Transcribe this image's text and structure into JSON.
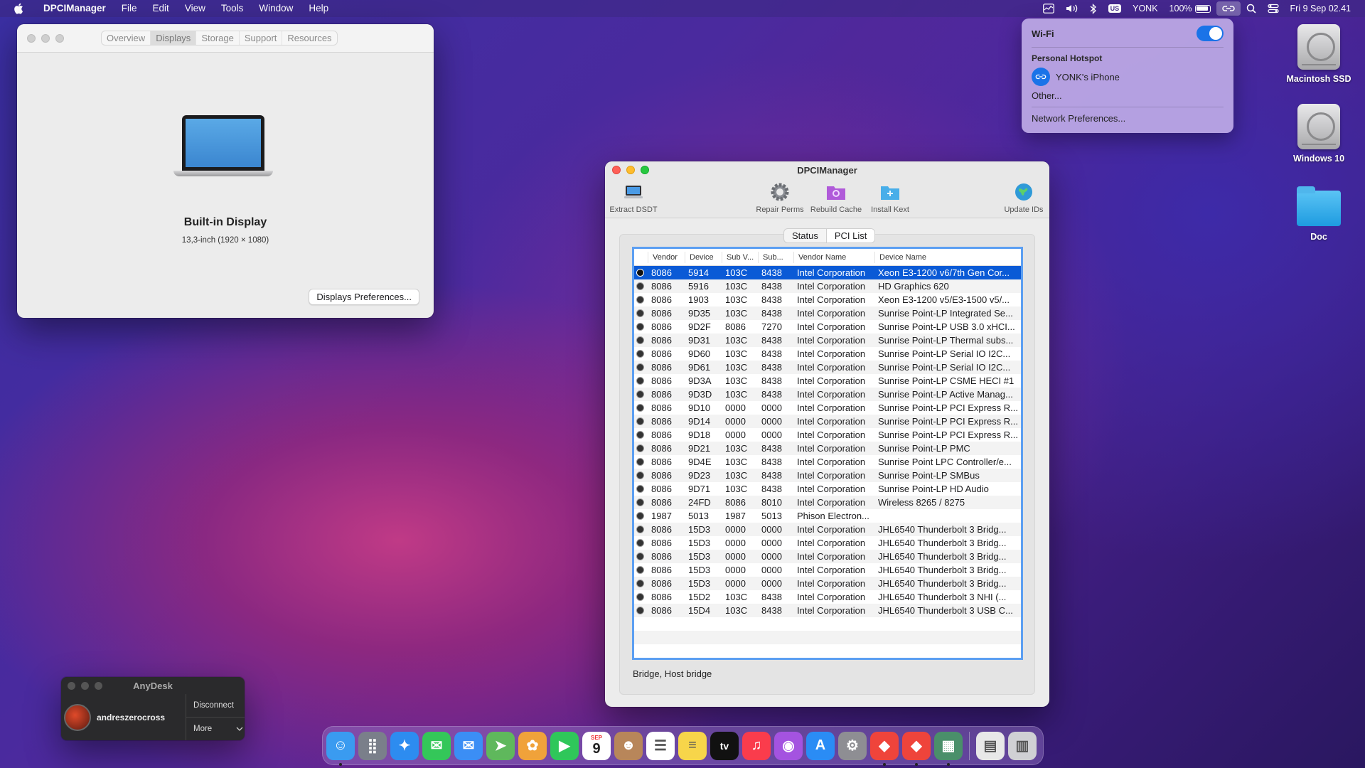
{
  "menubar": {
    "apple_icon": "apple-icon",
    "app_name": "DPCIManager",
    "menus": [
      "File",
      "Edit",
      "View",
      "Tools",
      "Window",
      "Help"
    ],
    "keyboard_badge": "US",
    "user": "YONK",
    "battery_percent": "100%",
    "datetime": "Fri 9 Sep  02.41"
  },
  "sysinfo": {
    "tabs": [
      "Overview",
      "Displays",
      "Storage",
      "Support",
      "Resources"
    ],
    "active_tab": "Displays",
    "display_name": "Built-in Display",
    "display_detail": "13,3-inch (1920 × 1080)",
    "prefs_button": "Displays Preferences..."
  },
  "dpci": {
    "title": "DPCIManager",
    "toolbar": {
      "extract": "Extract DSDT",
      "repair": "Repair Perms",
      "rebuild": "Rebuild Cache",
      "install": "Install Kext",
      "update": "Update IDs"
    },
    "tabs": [
      "Status",
      "PCI List"
    ],
    "active_tab": "PCI List",
    "columns": [
      "Vendor",
      "Device",
      "Sub V...",
      "Sub...",
      "Vendor Name",
      "Device Name"
    ],
    "rows": [
      [
        "8086",
        "5914",
        "103C",
        "8438",
        "Intel Corporation",
        "Xeon E3-1200 v6/7th Gen Cor..."
      ],
      [
        "8086",
        "5916",
        "103C",
        "8438",
        "Intel Corporation",
        "HD Graphics 620"
      ],
      [
        "8086",
        "1903",
        "103C",
        "8438",
        "Intel Corporation",
        "Xeon E3-1200 v5/E3-1500 v5/..."
      ],
      [
        "8086",
        "9D35",
        "103C",
        "8438",
        "Intel Corporation",
        "Sunrise Point-LP Integrated Se..."
      ],
      [
        "8086",
        "9D2F",
        "8086",
        "7270",
        "Intel Corporation",
        "Sunrise Point-LP USB 3.0 xHCI..."
      ],
      [
        "8086",
        "9D31",
        "103C",
        "8438",
        "Intel Corporation",
        "Sunrise Point-LP Thermal subs..."
      ],
      [
        "8086",
        "9D60",
        "103C",
        "8438",
        "Intel Corporation",
        "Sunrise Point-LP Serial IO I2C..."
      ],
      [
        "8086",
        "9D61",
        "103C",
        "8438",
        "Intel Corporation",
        "Sunrise Point-LP Serial IO I2C..."
      ],
      [
        "8086",
        "9D3A",
        "103C",
        "8438",
        "Intel Corporation",
        "Sunrise Point-LP CSME HECI #1"
      ],
      [
        "8086",
        "9D3D",
        "103C",
        "8438",
        "Intel Corporation",
        "Sunrise Point-LP Active Manag..."
      ],
      [
        "8086",
        "9D10",
        "0000",
        "0000",
        "Intel Corporation",
        "Sunrise Point-LP PCI Express R..."
      ],
      [
        "8086",
        "9D14",
        "0000",
        "0000",
        "Intel Corporation",
        "Sunrise Point-LP PCI Express R..."
      ],
      [
        "8086",
        "9D18",
        "0000",
        "0000",
        "Intel Corporation",
        "Sunrise Point-LP PCI Express R..."
      ],
      [
        "8086",
        "9D21",
        "103C",
        "8438",
        "Intel Corporation",
        "Sunrise Point-LP PMC"
      ],
      [
        "8086",
        "9D4E",
        "103C",
        "8438",
        "Intel Corporation",
        "Sunrise Point LPC Controller/e..."
      ],
      [
        "8086",
        "9D23",
        "103C",
        "8438",
        "Intel Corporation",
        "Sunrise Point-LP SMBus"
      ],
      [
        "8086",
        "9D71",
        "103C",
        "8438",
        "Intel Corporation",
        "Sunrise Point-LP HD Audio"
      ],
      [
        "8086",
        "24FD",
        "8086",
        "8010",
        "Intel Corporation",
        "Wireless 8265 / 8275"
      ],
      [
        "1987",
        "5013",
        "1987",
        "5013",
        "Phison Electron...",
        ""
      ],
      [
        "8086",
        "15D3",
        "0000",
        "0000",
        "Intel Corporation",
        "JHL6540 Thunderbolt 3 Bridg..."
      ],
      [
        "8086",
        "15D3",
        "0000",
        "0000",
        "Intel Corporation",
        "JHL6540 Thunderbolt 3 Bridg..."
      ],
      [
        "8086",
        "15D3",
        "0000",
        "0000",
        "Intel Corporation",
        "JHL6540 Thunderbolt 3 Bridg..."
      ],
      [
        "8086",
        "15D3",
        "0000",
        "0000",
        "Intel Corporation",
        "JHL6540 Thunderbolt 3 Bridg..."
      ],
      [
        "8086",
        "15D3",
        "0000",
        "0000",
        "Intel Corporation",
        "JHL6540 Thunderbolt 3 Bridg..."
      ],
      [
        "8086",
        "15D2",
        "103C",
        "8438",
        "Intel Corporation",
        "JHL6540 Thunderbolt 3 NHI (..."
      ],
      [
        "8086",
        "15D4",
        "103C",
        "8438",
        "Intel Corporation",
        "JHL6540 Thunderbolt 3 USB C..."
      ]
    ],
    "selected_row": 0,
    "status_text": "Bridge, Host bridge"
  },
  "wifi_menu": {
    "title": "Wi-Fi",
    "enabled": true,
    "section": "Personal Hotspot",
    "hotspot_name": "YONK's iPhone",
    "other": "Other...",
    "network_prefs": "Network Preferences..."
  },
  "desktop": {
    "items": [
      "Macintosh SSD",
      "Windows 10",
      "Doc"
    ]
  },
  "anydesk": {
    "title": "AnyDesk",
    "user": "andreszerocross",
    "disconnect": "Disconnect",
    "more": "More"
  },
  "dock": {
    "apps": [
      {
        "name": "Finder",
        "icon": "finder-icon",
        "color": "#3a9bf0"
      },
      {
        "name": "Launchpad",
        "icon": "launchpad-icon",
        "color": "#7a7f8a"
      },
      {
        "name": "Safari",
        "icon": "safari-icon",
        "color": "#2d8cf0"
      },
      {
        "name": "Messages",
        "icon": "messages-icon",
        "color": "#34c759"
      },
      {
        "name": "Mail",
        "icon": "mail-icon",
        "color": "#3b8ef5"
      },
      {
        "name": "Maps",
        "icon": "maps-icon",
        "color": "#5fb85c"
      },
      {
        "name": "Photos",
        "icon": "photos-icon",
        "color": "#f0a23a"
      },
      {
        "name": "FaceTime",
        "icon": "facetime-icon",
        "color": "#2fc75a"
      },
      {
        "name": "Calendar",
        "icon": "calendar-icon",
        "color": "#ffffff"
      },
      {
        "name": "Contacts",
        "icon": "contacts-icon",
        "color": "#b8865a"
      },
      {
        "name": "Reminders",
        "icon": "reminders-icon",
        "color": "#ffffff"
      },
      {
        "name": "Notes",
        "icon": "notes-icon",
        "color": "#f7d54a"
      },
      {
        "name": "TV",
        "icon": "tv-icon",
        "color": "#111111"
      },
      {
        "name": "Music",
        "icon": "music-icon",
        "color": "#fa3c4c"
      },
      {
        "name": "Podcasts",
        "icon": "podcasts-icon",
        "color": "#a453e0"
      },
      {
        "name": "App Store",
        "icon": "appstore-icon",
        "color": "#2a8cf5"
      },
      {
        "name": "System Preferences",
        "icon": "settings-icon",
        "color": "#8e8e93"
      },
      {
        "name": "AnyDesk",
        "icon": "anydesk-icon",
        "color": "#ef443b"
      },
      {
        "name": "AnyDesk Remote",
        "icon": "anydesk-remote-icon",
        "color": "#ef443b"
      },
      {
        "name": "DPCIManager",
        "icon": "dpcimanager-icon",
        "color": "#4a8f6a"
      }
    ],
    "calendar_month": "SEP",
    "calendar_day": "9",
    "tv_label": "tv",
    "extra": [
      {
        "name": "Document",
        "icon": "document-icon",
        "color": "#e8e8e8"
      },
      {
        "name": "Trash",
        "icon": "trash-icon",
        "color": "#d0d0d4"
      }
    ]
  }
}
